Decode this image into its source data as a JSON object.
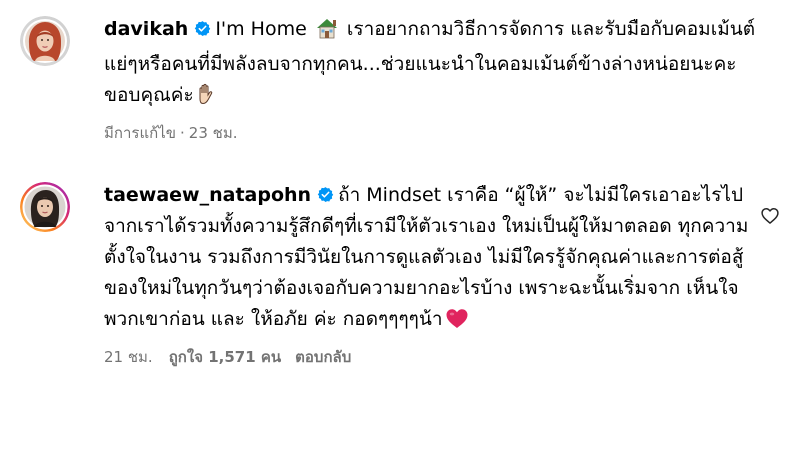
{
  "comments": [
    {
      "username": "davikah",
      "verified": true,
      "avatar_icon": "profile-photo-woman-red-hair",
      "text_before_emoji": "I'm Home",
      "emoji_house": "house-emoji",
      "text_after_emoji": "เราอยากถามวิธีการจัดการ และรับมือกับคอมเม้นต์แย่ๆหรือคนที่มีพลังลบจากทุกคน...ช่วยแนะนำในคอมเม้นต์ข้างล่างหน่อยนะคะขอบคุณค่ะ",
      "emoji_end": "waving-hand-emoji",
      "edited": "มีการแก้ไข",
      "dot": "·",
      "time": "23 ชม."
    },
    {
      "username": "taewaew_natapohn",
      "verified": true,
      "avatar_icon": "profile-photo-woman-dark-hair",
      "text": "ถ้า Mindset เราคือ “ผู้ให้” จะไม่มีใครเอาอะไรไปจากเราได้รวมทั้งความรู้สึกดีๆที่เรามีให้ตัวเราเอง ใหม่เป็นผู้ให้มาตลอด ทุกความตั้งใจในงาน รวมถึงการมีวินัยในการดูแลตัวเอง ไม่มีใครรู้จักคุณค่าและการต่อสู้ของใหม่ในทุกวันๆว่าต้องเจอกับความยากอะไรบ้าง เพราะฉะนั้นเริ่มจาก เห็นใจพวกเขาก่อน และ ให้อภัย ค่ะ กอดๆๆๆๆน้า",
      "emoji_end": "red-heart-emoji",
      "time": "21 ชม.",
      "likes": "ถูกใจ 1,571 คน",
      "reply": "ตอบกลับ",
      "like_icon": "heart-outline-icon"
    }
  ],
  "colors": {
    "text": "#000000",
    "secondary": "#737373",
    "verified_badge": "#0095F6",
    "heart_red": "#E0245E"
  }
}
